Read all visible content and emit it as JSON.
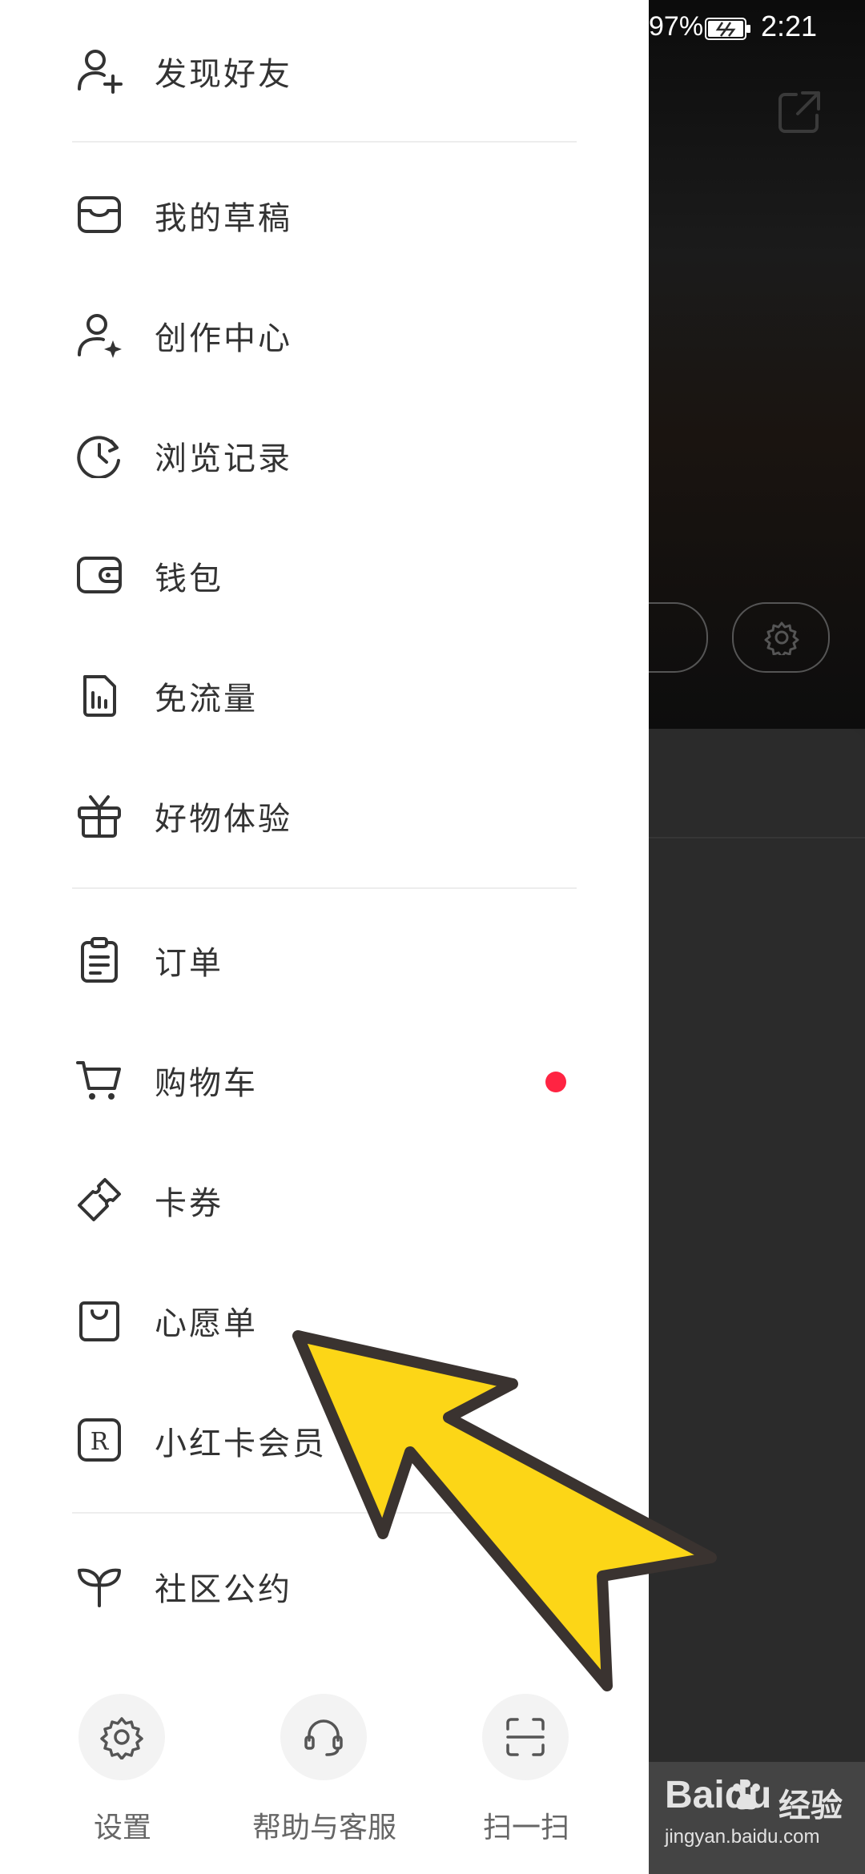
{
  "status_bar": {
    "battery": "97%",
    "time": "2:21"
  },
  "drawer": {
    "items": [
      {
        "label": "发现好友",
        "icon": "add-user-icon"
      },
      {
        "label": "我的草稿",
        "icon": "inbox-icon"
      },
      {
        "label": "创作中心",
        "icon": "creator-icon"
      },
      {
        "label": "浏览记录",
        "icon": "history-clock-icon"
      },
      {
        "label": "钱包",
        "icon": "wallet-icon"
      },
      {
        "label": "免流量",
        "icon": "data-sim-icon"
      },
      {
        "label": "好物体验",
        "icon": "gift-icon"
      },
      {
        "label": "订单",
        "icon": "clipboard-icon"
      },
      {
        "label": "购物车",
        "icon": "cart-icon"
      },
      {
        "label": "卡券",
        "icon": "ticket-icon"
      },
      {
        "label": "心愿单",
        "icon": "shopping-bag-icon"
      },
      {
        "label": "小红卡会员",
        "icon": "r-badge-icon"
      },
      {
        "label": "社区公约",
        "icon": "sprout-icon"
      }
    ],
    "bottom": [
      {
        "label": "设置",
        "icon": "gear-icon"
      },
      {
        "label": "帮助与客服",
        "icon": "headset-icon"
      },
      {
        "label": "扫一扫",
        "icon": "scan-icon"
      }
    ],
    "cart_badge_color": "#ff2442"
  },
  "watermark": {
    "brand": "Baidu",
    "brand_suffix": "经验",
    "sub": "jingyan.baidu.com"
  },
  "overlay": {
    "arrow_color": "#fcd617",
    "arrow_outline": "#3a3330"
  }
}
